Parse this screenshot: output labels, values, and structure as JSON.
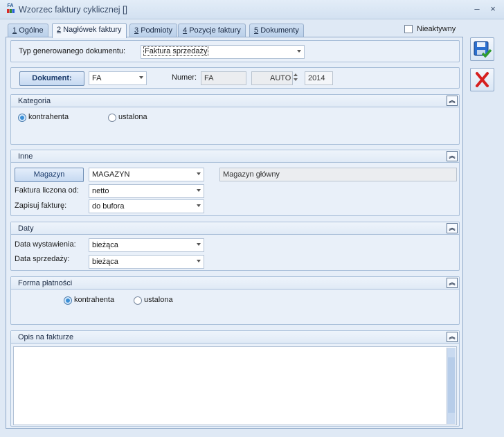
{
  "window": {
    "title": "Wzorzec faktury cyklicznej []",
    "icon_label": "FA",
    "minimize": "–",
    "close": "×"
  },
  "tabs": [
    {
      "key": "1",
      "label": "Ogólne"
    },
    {
      "key": "2",
      "label": "Nagłówek faktury"
    },
    {
      "key": "3",
      "label": "Podmioty"
    },
    {
      "key": "4",
      "label": "Pozycje faktury"
    },
    {
      "key": "5",
      "label": "Dokumenty"
    }
  ],
  "active_tab": "2",
  "inactive_checkbox": {
    "label": "Nieaktywny",
    "checked": false
  },
  "header": {
    "doc_type_label": "Typ generowanego dokumentu:",
    "doc_type_value": "Faktura sprzedaży"
  },
  "document": {
    "button": "Dokument:",
    "symbol": "FA",
    "numer_label": "Numer:",
    "numer_prefix": "FA",
    "numer_auto": "AUTO",
    "numer_year": "2014"
  },
  "kategoria": {
    "title": "Kategoria",
    "options": [
      "kontrahenta",
      "ustalona"
    ],
    "selected": "kontrahenta"
  },
  "inne": {
    "title": "Inne",
    "magazyn_button": "Magazyn",
    "magazyn_value": "MAGAZYN",
    "magazyn_name": "Magazyn główny",
    "liczona_label": "Faktura liczona od:",
    "liczona_value": "netto",
    "zapisuj_label": "Zapisuj fakturę:",
    "zapisuj_value": "do bufora"
  },
  "daty": {
    "title": "Daty",
    "wystawienia_label": "Data wystawienia:",
    "wystawienia_value": "bieżąca",
    "sprzedazy_label": "Data sprzedaży:",
    "sprzedazy_value": "bieżąca"
  },
  "platnosc": {
    "title": "Forma płatności",
    "options": [
      "kontrahenta",
      "ustalona"
    ],
    "selected": "kontrahenta"
  },
  "opis": {
    "title": "Opis na fakturze",
    "value": ""
  },
  "colors": {
    "accent": "#3b8fd6",
    "save_icon": "#2b6fcf",
    "cancel_icon": "#d62020"
  },
  "icons": [
    "save-icon",
    "cancel-icon",
    "collapse-up-icon",
    "dropdown-arrow-icon"
  ]
}
